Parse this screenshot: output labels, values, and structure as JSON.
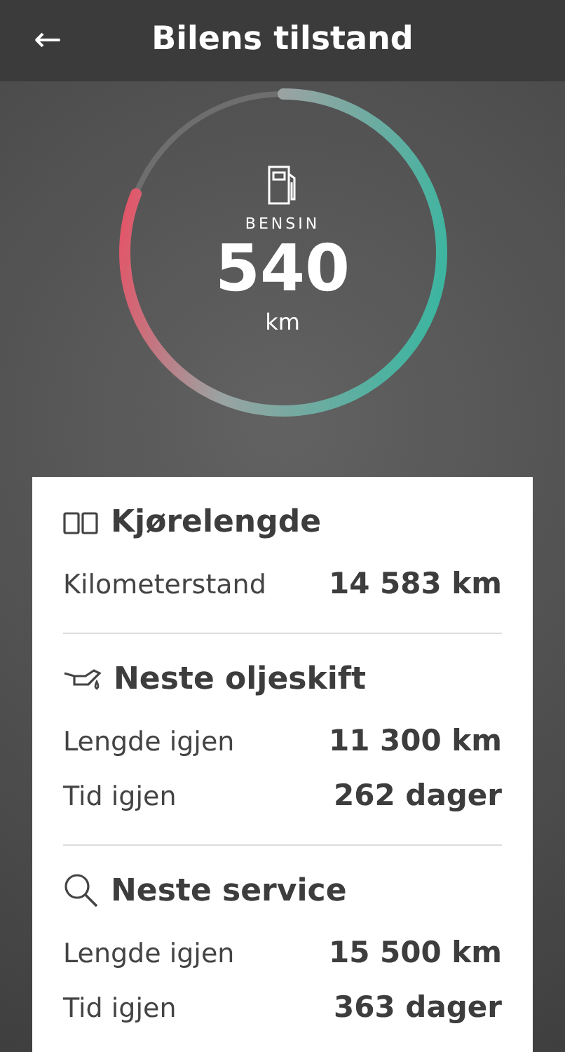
{
  "header": {
    "back": "←",
    "title": "Bilens tilstand"
  },
  "fuel": {
    "label": "BENSIN",
    "value": "540",
    "unit": "km",
    "level": 0.81
  },
  "sections": [
    {
      "kind": "odometer",
      "title": "Kjørelengde",
      "rows": [
        {
          "label": "Kilometerstand",
          "value": "14 583 km"
        }
      ]
    },
    {
      "kind": "oil",
      "title": "Neste oljeskift",
      "rows": [
        {
          "label": "Lengde igjen",
          "value": "11 300 km"
        },
        {
          "label": "Tid igjen",
          "value": "262 dager"
        }
      ]
    },
    {
      "kind": "service",
      "title": "Neste service",
      "rows": [
        {
          "label": "Lengde igjen",
          "value": "15 500 km"
        },
        {
          "label": "Tid igjen",
          "value": "363 dager"
        }
      ]
    }
  ]
}
